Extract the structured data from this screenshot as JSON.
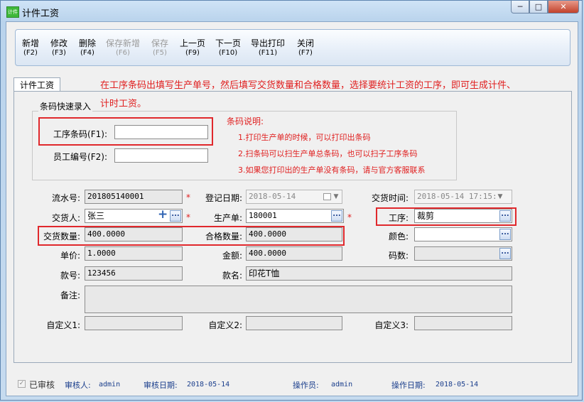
{
  "window": {
    "title": "计件工资",
    "icon_text": "计件",
    "buttons": [
      "0",
      "1",
      "r"
    ]
  },
  "toolbar": {
    "items": [
      {
        "label": "新增",
        "key": "(F2)"
      },
      {
        "label": "修改",
        "key": "(F3)"
      },
      {
        "label": "删除",
        "key": "(F4)"
      },
      {
        "label": "保存新增",
        "key": "(F6)"
      },
      {
        "label": "保存",
        "key": "(F5)"
      },
      {
        "label": "上一页",
        "key": "(F9)"
      },
      {
        "label": "下一页",
        "key": "(F10)"
      },
      {
        "label": "导出打印",
        "key": "(F11)"
      },
      {
        "label": "关闭",
        "key": "(F7)"
      }
    ]
  },
  "tab": {
    "label": "计件工资"
  },
  "hint": {
    "line1": "在工序条码出填写生产单号，然后填写交货数量和合格数量，选择要统计工资的工序，即可生成计件、",
    "line2": "计时工资。"
  },
  "quick_entry": {
    "title": "条码快速录入",
    "process_barcode_label": "工序条码(F1):",
    "process_barcode_value": "",
    "employee_no_label": "员工编号(F2):",
    "employee_no_value": ""
  },
  "barcode_note": {
    "title": "条码说明:",
    "lines": [
      "1.打印生产单的时候，可以打印出条码",
      "2.扫条码可以扫生产单总条码，也可以扫子工序条码",
      "3.如果您打印出的生产单没有条码，请与官方客服联系"
    ]
  },
  "form": {
    "serial_label": "流水号:",
    "serial_value": "201805140001",
    "reg_date_label": "登记日期:",
    "reg_date_value": "2018-05-14",
    "delivery_time_label": "交货时间:",
    "delivery_time_value": "2018-05-14 17:15:",
    "deliverer_label": "交货人:",
    "deliverer_value": "张三",
    "order_label": "生产单:",
    "order_value": "180001",
    "process_label": "工序:",
    "process_value": "裁剪",
    "delivered_qty_label": "交货数量:",
    "delivered_qty_value": "400.0000",
    "qualified_qty_label": "合格数量:",
    "qualified_qty_value": "400.0000",
    "color_label": "颜色:",
    "color_value": "",
    "unit_price_label": "单价:",
    "unit_price_value": "1.0000",
    "amount_label": "金额:",
    "amount_value": "400.0000",
    "size_label": "码数:",
    "size_value": "",
    "style_no_label": "款号:",
    "style_no_value": "123456",
    "style_name_label": "款名:",
    "style_name_value": "印花T恤",
    "remark_label": "备注:",
    "remark_value": "",
    "custom1_label": "自定义1:",
    "custom1_value": "",
    "custom2_label": "自定义2:",
    "custom2_value": "",
    "custom3_label": "自定义3:",
    "custom3_value": "",
    "required_mark": "*"
  },
  "status": {
    "audited_label": "已审核",
    "auditor_label": "审核人:",
    "auditor_value": "admin",
    "audit_date_label": "审核日期:",
    "audit_date_value": "2018-05-14",
    "operator_label": "操作员:",
    "operator_value": "admin",
    "op_date_label": "操作日期:",
    "op_date_value": "2018-05-14"
  },
  "colors": {
    "hint_red": "#e02020",
    "status_blue": "#1a3e8c",
    "highlight_red": "#e0282c"
  }
}
